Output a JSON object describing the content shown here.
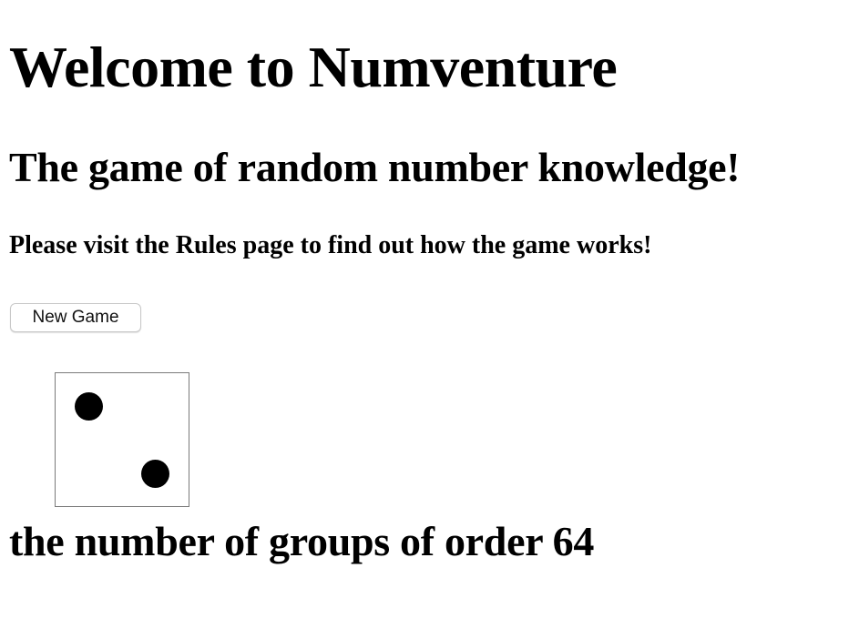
{
  "page": {
    "title": "Welcome to Numventure",
    "subtitle": "The game of random number knowledge!",
    "instructions": "Please visit the Rules page to find out how the game works!",
    "new_game_label": "New Game"
  },
  "die": {
    "value": 2,
    "pip_color": "#000000",
    "border_color": "#7a7a7a"
  },
  "question": {
    "text": "the number of groups of order 64"
  }
}
